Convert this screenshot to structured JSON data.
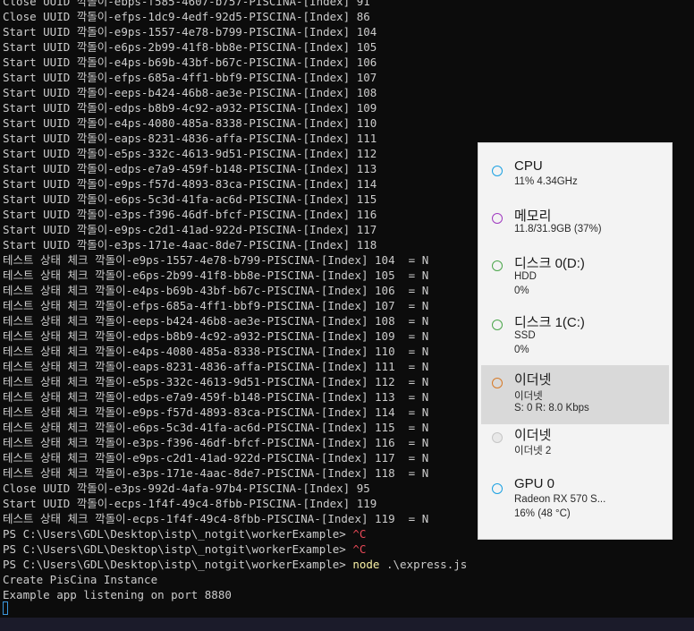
{
  "terminal": {
    "lines": [
      "Close UUID 깍돌이-ebps-f585-4607-b757-PISCINA-[Index] 91",
      "Close UUID 깍돌이-efps-1dc9-4edf-92d5-PISCINA-[Index] 86",
      "Start UUID 깍돌이-e9ps-1557-4e78-b799-PISCINA-[Index] 104",
      "Start UUID 깍돌이-e6ps-2b99-41f8-bb8e-PISCINA-[Index] 105",
      "Start UUID 깍돌이-e4ps-b69b-43bf-b67c-PISCINA-[Index] 106",
      "Start UUID 깍돌이-efps-685a-4ff1-bbf9-PISCINA-[Index] 107",
      "Start UUID 깍돌이-eeps-b424-46b8-ae3e-PISCINA-[Index] 108",
      "Start UUID 깍돌이-edps-b8b9-4c92-a932-PISCINA-[Index] 109",
      "Start UUID 깍돌이-e4ps-4080-485a-8338-PISCINA-[Index] 110",
      "Start UUID 깍돌이-eaps-8231-4836-affa-PISCINA-[Index] 111",
      "Start UUID 깍돌이-e5ps-332c-4613-9d51-PISCINA-[Index] 112",
      "Start UUID 깍돌이-edps-e7a9-459f-b148-PISCINA-[Index] 113",
      "Start UUID 깍돌이-e9ps-f57d-4893-83ca-PISCINA-[Index] 114",
      "Start UUID 깍돌이-e6ps-5c3d-41fa-ac6d-PISCINA-[Index] 115",
      "Start UUID 깍돌이-e3ps-f396-46df-bfcf-PISCINA-[Index] 116",
      "Start UUID 깍돌이-e9ps-c2d1-41ad-922d-PISCINA-[Index] 117",
      "Start UUID 깍돌이-e3ps-171e-4aac-8de7-PISCINA-[Index] 118",
      "테스트 상태 체크 깍돌이-e9ps-1557-4e78-b799-PISCINA-[Index] 104  = N",
      "테스트 상태 체크 깍돌이-e6ps-2b99-41f8-bb8e-PISCINA-[Index] 105  = N",
      "테스트 상태 체크 깍돌이-e4ps-b69b-43bf-b67c-PISCINA-[Index] 106  = N",
      "테스트 상태 체크 깍돌이-efps-685a-4ff1-bbf9-PISCINA-[Index] 107  = N",
      "테스트 상태 체크 깍돌이-eeps-b424-46b8-ae3e-PISCINA-[Index] 108  = N",
      "테스트 상태 체크 깍돌이-edps-b8b9-4c92-a932-PISCINA-[Index] 109  = N",
      "테스트 상태 체크 깍돌이-e4ps-4080-485a-8338-PISCINA-[Index] 110  = N",
      "테스트 상태 체크 깍돌이-eaps-8231-4836-affa-PISCINA-[Index] 111  = N",
      "테스트 상태 체크 깍돌이-e5ps-332c-4613-9d51-PISCINA-[Index] 112  = N",
      "테스트 상태 체크 깍돌이-edps-e7a9-459f-b148-PISCINA-[Index] 113  = N",
      "테스트 상태 체크 깍돌이-e9ps-f57d-4893-83ca-PISCINA-[Index] 114  = N",
      "테스트 상태 체크 깍돌이-e6ps-5c3d-41fa-ac6d-PISCINA-[Index] 115  = N",
      "테스트 상태 체크 깍돌이-e3ps-f396-46df-bfcf-PISCINA-[Index] 116  = N",
      "테스트 상태 체크 깍돌이-e9ps-c2d1-41ad-922d-PISCINA-[Index] 117  = N",
      "테스트 상태 체크 깍돌이-e3ps-171e-4aac-8de7-PISCINA-[Index] 118  = N",
      "Close UUID 깍돌이-e3ps-992d-4afa-97b4-PISCINA-[Index] 95",
      "Start UUID 깍돌이-ecps-1f4f-49c4-8fbb-PISCINA-[Index] 119",
      "테스트 상태 체크 깍돌이-ecps-1f4f-49c4-8fbb-PISCINA-[Index] 119  = N"
    ],
    "prompt_lines": [
      {
        "prompt": "PS C:\\Users\\GDL\\Desktop\\istp\\_notgit\\workerExample> ",
        "ctrl": "^C",
        "cmd": "",
        "args": ""
      },
      {
        "prompt": "PS C:\\Users\\GDL\\Desktop\\istp\\_notgit\\workerExample> ",
        "ctrl": "^C",
        "cmd": "",
        "args": ""
      },
      {
        "prompt": "PS C:\\Users\\GDL\\Desktop\\istp\\_notgit\\workerExample> ",
        "ctrl": "",
        "cmd": "node",
        "args": " .\\express.js"
      }
    ],
    "output_lines": [
      "Create PisCina Instance",
      "Example app listening on port 8880"
    ]
  },
  "perf_panel": {
    "items": [
      {
        "title": "CPU",
        "lines": [
          "11% 4.34GHz"
        ],
        "color": "#1ba1e2",
        "fill": "transparent",
        "selected": false
      },
      {
        "title": "메모리",
        "lines": [
          "11.8/31.9GB (37%)"
        ],
        "color": "#a03ac0",
        "fill": "transparent",
        "selected": false
      },
      {
        "title": "디스크 0(D:)",
        "lines": [
          "HDD",
          "0%"
        ],
        "color": "#4ca64c",
        "fill": "transparent",
        "selected": false
      },
      {
        "title": "디스크 1(C:)",
        "lines": [
          "SSD",
          "0%"
        ],
        "color": "#4ca64c",
        "fill": "transparent",
        "selected": false
      },
      {
        "title": "이더넷",
        "lines": [
          "이더넷",
          "S: 0 R: 8.0 Kbps"
        ],
        "color": "#d77a28",
        "fill": "transparent",
        "selected": true
      },
      {
        "title": "이더넷",
        "lines": [
          "이더넷 2"
        ],
        "color": "#c6c6c6",
        "fill": "#e8e8e8",
        "selected": false
      },
      {
        "title": "GPU 0",
        "lines": [
          "Radeon RX 570 S...",
          "16% (48 °C)"
        ],
        "color": "#1ba1e2",
        "fill": "transparent",
        "selected": false
      }
    ]
  }
}
